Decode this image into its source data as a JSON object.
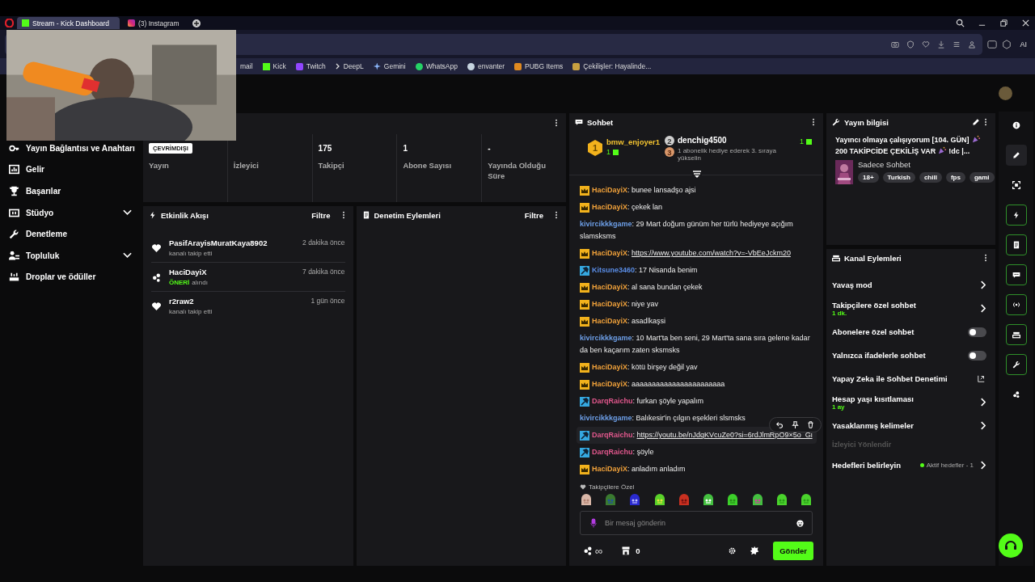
{
  "browser": {
    "tabs": [
      {
        "title": "Stream - Kick Dashboard",
        "selected": true
      },
      {
        "title": "(3) Instagram",
        "selected": false
      }
    ],
    "bookmarks": [
      {
        "label": "mail",
        "kind": "none"
      },
      {
        "label": "Kick",
        "kind": "kick"
      },
      {
        "label": "Twitch",
        "kind": "twitch"
      },
      {
        "label": "DeepL",
        "kind": "chevron"
      },
      {
        "label": "Gemini",
        "kind": "star"
      },
      {
        "label": "WhatsApp",
        "kind": "whatsapp"
      },
      {
        "label": "envanter",
        "kind": "steam"
      },
      {
        "label": "PUBG Items",
        "kind": "pubg"
      },
      {
        "label": "Çekilişler: Hayalinde...",
        "kind": "gift"
      }
    ],
    "ai_label": "AI"
  },
  "sidebar": {
    "items": [
      {
        "label": "Yayın Bağlantısı ve Anahtarı",
        "kind": "key",
        "expandable": false
      },
      {
        "label": "Gelir",
        "kind": "chart",
        "expandable": false
      },
      {
        "label": "Başarılar",
        "kind": "trophy",
        "expandable": false
      },
      {
        "label": "Stüdyo",
        "kind": "studio",
        "expandable": true
      },
      {
        "label": "Denetleme",
        "kind": "wrench",
        "expandable": false
      },
      {
        "label": "Topluluk",
        "kind": "people",
        "expandable": true
      },
      {
        "label": "Droplar ve ödüller",
        "kind": "drops",
        "expandable": false
      }
    ]
  },
  "stats": {
    "items": [
      {
        "badge": "ÇEVRİMDIŞI",
        "label": "Yayın"
      },
      {
        "label": "İzleyici"
      },
      {
        "value": "175",
        "label": "Takipçi"
      },
      {
        "value": "1",
        "label": "Abone Sayısı"
      },
      {
        "value": "-",
        "label": "Yayında Olduğu Süre"
      }
    ]
  },
  "activity": {
    "title": "Etkinlik Akışı",
    "filter": "Filtre",
    "events": [
      {
        "kind": "follow",
        "user": "PasifArayisMuratKaya8902",
        "time": "2 dakika önce",
        "action": "kanalı takip etti"
      },
      {
        "kind": "suggestion",
        "user": "HaciDayiX",
        "time": "7 dakika önce",
        "highlight": "ÖNERİ",
        "action": "alındı"
      },
      {
        "kind": "follow",
        "user": "r2raw2",
        "time": "1 gün önce",
        "action": "kanalı takip etti"
      }
    ]
  },
  "moderation": {
    "title": "Denetim Eylemleri",
    "filter": "Filtre"
  },
  "chat": {
    "title": "Sohbet",
    "separator": ":",
    "leaders": [
      {
        "rank": "1",
        "user": "bmw_enjoyer1",
        "count": "1"
      },
      {
        "rank": "2",
        "user": "denchig4500",
        "count": "1"
      }
    ],
    "promo": {
      "rank": "3",
      "text": "1 abonelik hediye ederek 3. sıraya yükselin"
    },
    "messages": [
      {
        "kind": "crown",
        "user": "HaciDayiX",
        "color": "#f0a13a",
        "text": "bunee lansadşo ajsi",
        "link": false,
        "hovered": false
      },
      {
        "kind": "crown",
        "user": "HaciDayiX",
        "color": "#f0a13a",
        "text": "çekek lan",
        "link": false,
        "hovered": false
      },
      {
        "kind": "plain",
        "user": "kivircikkkgame",
        "color": "#6d9fe8",
        "text": "29 Mart doğum günüm her türlü hediyeye açığım slamsksms",
        "link": false,
        "hovered": false
      },
      {
        "kind": "crown",
        "user": "HaciDayiX",
        "color": "#f0a13a",
        "text": "https://www.youtube.com/watch?v=-VbEeJckm20",
        "link": true,
        "hovered": false
      },
      {
        "kind": "mod",
        "user": "Kitsune3460",
        "color": "#5a8de6",
        "text": "17 Nisanda benim",
        "link": false,
        "hovered": false
      },
      {
        "kind": "crown",
        "user": "HaciDayiX",
        "color": "#f0a13a",
        "text": "al sana bundan çekek",
        "link": false,
        "hovered": false
      },
      {
        "kind": "crown",
        "user": "HaciDayiX",
        "color": "#f0a13a",
        "text": "niye yav",
        "link": false,
        "hovered": false
      },
      {
        "kind": "crown",
        "user": "HaciDayiX",
        "color": "#f0a13a",
        "text": "asadlkaşsi",
        "link": false,
        "hovered": false
      },
      {
        "kind": "plain",
        "user": "kivircikkkgame",
        "color": "#6d9fe8",
        "text": "10 Mart'ta ben seni, 29 Mart'ta sana sıra gelene kadar da ben kaçarım zaten sksmsks",
        "link": false,
        "hovered": false
      },
      {
        "kind": "crown",
        "user": "HaciDayiX",
        "color": "#f0a13a",
        "text": "kötü birşey değil yav",
        "link": false,
        "hovered": false
      },
      {
        "kind": "crown",
        "user": "HaciDayiX",
        "color": "#f0a13a",
        "text": "aaaaaaaaaaaaaaaaaaaaaaa",
        "link": false,
        "hovered": false
      },
      {
        "kind": "mod",
        "user": "DarqRaichu",
        "color": "#e0578c",
        "text": "furkan şöyle yapalım",
        "link": false,
        "hovered": false
      },
      {
        "kind": "plain",
        "user": "kivircikkkgame",
        "color": "#6d9fe8",
        "text": "Balıkesir'in çılgın eşekleri slsmsks",
        "link": false,
        "hovered": false
      },
      {
        "kind": "mod",
        "user": "DarqRaichu",
        "color": "#e0578c",
        "text": "https://youtu.be/nJdqKVcuZe0?si=6rdJlmRpO9×5o_Gi",
        "link": true,
        "hovered": true
      },
      {
        "kind": "mod",
        "user": "DarqRaichu",
        "color": "#e0578c",
        "text": "şöyle",
        "link": false,
        "hovered": false
      },
      {
        "kind": "crown",
        "user": "HaciDayiX",
        "color": "#f0a13a",
        "text": "anladım anladım",
        "link": false,
        "hovered": false
      }
    ],
    "emote_label": "Takipçilere Özel",
    "input": {
      "placeholder": "Bir mesaj gönderin"
    },
    "infinity": "∞",
    "points": "0",
    "send": "Gönder"
  },
  "stream_info": {
    "title": "Yayın bilgisi",
    "stream_title": [
      "Yayıncı olmaya çalışıyorum [104. GÜN]",
      "200 TAKİPCİDE ÇEKİLİŞ VAR",
      "!dc |..."
    ],
    "category": "Sadece Sohbet",
    "tags": [
      "18+",
      "Turkish",
      "chill",
      "fps",
      "gami"
    ]
  },
  "channel_actions": {
    "title": "Kanal Eylemleri",
    "items": [
      {
        "kind": "link",
        "label": "Yavaş mod"
      },
      {
        "kind": "link",
        "label": "Takipçilere özel sohbet",
        "sub": "1 dk."
      },
      {
        "kind": "toggle",
        "label": "Abonelere özel sohbet",
        "on": false
      },
      {
        "kind": "toggle",
        "label": "Yalnızca ifadelerle sohbet",
        "on": false
      },
      {
        "kind": "external",
        "label": "Yapay Zeka ile Sohbet Denetimi"
      },
      {
        "kind": "link",
        "label": "Hesap yaşı kısıtlaması",
        "sub": "1 ay"
      },
      {
        "kind": "link",
        "label": "Yasaklanmış kelimeler"
      },
      {
        "kind": "heading",
        "label": "İzleyici Yönlendir"
      },
      {
        "kind": "link",
        "label": "Hedefleri belirleyin",
        "status": "Aktif hedefler - 1"
      }
    ]
  },
  "rail": [
    {
      "kind": "info",
      "selected": false,
      "pinned": false
    },
    {
      "kind": "pencil",
      "selected": true,
      "pinned": false
    },
    {
      "kind": "focus",
      "selected": false,
      "pinned": false
    },
    {
      "kind": "bolt",
      "selected": false,
      "pinned": true
    },
    {
      "kind": "doc",
      "selected": false,
      "pinned": true
    },
    {
      "kind": "chat",
      "selected": false,
      "pinned": true
    },
    {
      "kind": "broadcast",
      "selected": false,
      "pinned": true
    },
    {
      "kind": "camera",
      "selected": false,
      "pinned": true
    },
    {
      "kind": "wrench",
      "selected": false,
      "pinned": true
    },
    {
      "kind": "dots",
      "selected": false,
      "pinned": false
    }
  ]
}
